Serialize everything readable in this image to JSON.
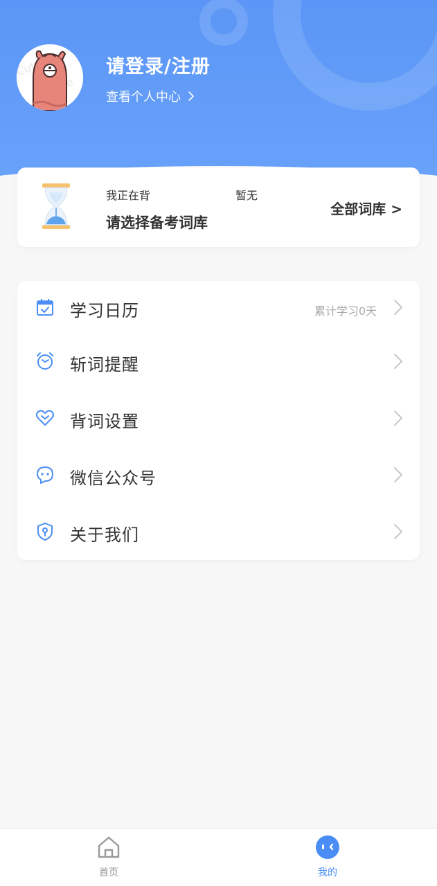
{
  "header": {
    "login_title": "请登录/注册",
    "profile_link": "查看个人中心",
    "gradient_colors": [
      "#5b96f6",
      "#6aa3fb"
    ]
  },
  "study_card": {
    "studying_label": "我正在背",
    "status_value": "暂无",
    "choose_prompt": "请选择备考词库",
    "all_library_label": "全部词库 >"
  },
  "menu": {
    "items": [
      {
        "label": "学习日历",
        "icon": "calendar-icon",
        "extra": "累计学习0天"
      },
      {
        "label": "斩词提醒",
        "icon": "alarm-clock-icon",
        "extra": ""
      },
      {
        "label": "背词设置",
        "icon": "heart-icon",
        "extra": ""
      },
      {
        "label": "微信公众号",
        "icon": "chat-bubble-icon",
        "extra": ""
      },
      {
        "label": "关于我们",
        "icon": "shield-icon",
        "extra": ""
      }
    ]
  },
  "tabbar": {
    "tabs": [
      {
        "label": "首页",
        "icon": "home-icon",
        "active": false
      },
      {
        "label": "我的",
        "icon": "face-icon",
        "active": true
      }
    ],
    "active_color": "#4a8ef5",
    "inactive_color": "#999999"
  },
  "colors": {
    "accent": "#5b96f6",
    "icon_blue": "#4a8ef5"
  }
}
